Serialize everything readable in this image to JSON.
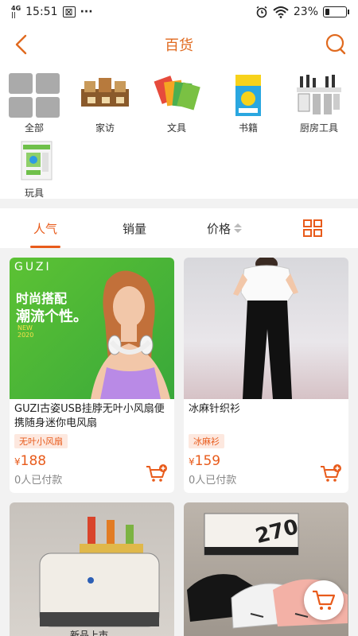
{
  "status": {
    "network": "4G",
    "signal_bars": "||",
    "time": "15:51",
    "dots": "···",
    "battery_text": "23%",
    "battery_level": 0.23
  },
  "header": {
    "title": "百货"
  },
  "categories": [
    {
      "label": "全部",
      "icon": "grid-icon"
    },
    {
      "label": "家访",
      "icon": "home-decor-icon"
    },
    {
      "label": "文具",
      "icon": "stationery-icon"
    },
    {
      "label": "书籍",
      "icon": "book-icon"
    },
    {
      "label": "厨房工具",
      "icon": "kitchen-tool-icon"
    },
    {
      "label": "玩具",
      "icon": "toy-icon"
    }
  ],
  "tabs": [
    {
      "label": "人气",
      "active": true
    },
    {
      "label": "销量",
      "active": false
    },
    {
      "label": "价格",
      "active": false
    }
  ],
  "products": [
    {
      "title": "GUZI古姿USB挂脖无叶小风扇便携随身迷你电风扇",
      "tag": "无叶小风扇",
      "currency": "¥",
      "price": "188",
      "sold": "0人已付款",
      "photo_text": {
        "brand": "GUZI",
        "slogan1": "时尚搭配",
        "slogan2": "潮流个性。",
        "badge1": "NEW",
        "badge2": "2020"
      }
    },
    {
      "title": "冰麻针织衫",
      "tag": "冰麻衫",
      "currency": "¥",
      "price": "159",
      "sold": "0人已付款"
    },
    {
      "photo_text": {
        "caption": "新品上市"
      }
    },
    {
      "photo_text": {
        "box_text": "270"
      }
    }
  ],
  "colors": {
    "accent": "#e85b1b",
    "title": "#e06a1f"
  }
}
